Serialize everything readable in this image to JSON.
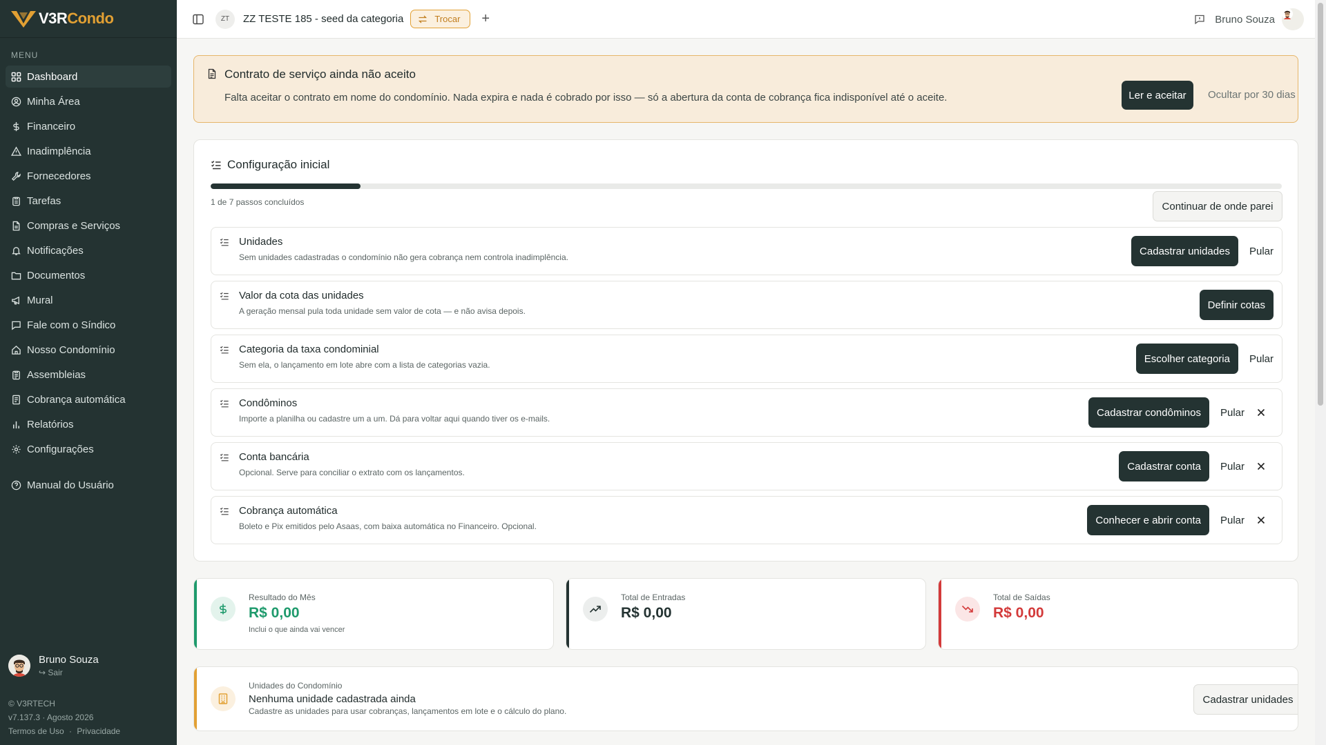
{
  "brand": {
    "part1": "V3R",
    "part2": "Condo"
  },
  "sidebar": {
    "menu_label": "MENU",
    "items": [
      {
        "label": "Dashboard",
        "icon": "dashboard-icon",
        "active": true
      },
      {
        "label": "Minha Área",
        "icon": "user-circle-icon"
      },
      {
        "label": "Financeiro",
        "icon": "dollar-icon"
      },
      {
        "label": "Inadimplência",
        "icon": "warning-triangle-icon"
      },
      {
        "label": "Fornecedores",
        "icon": "wrench-icon"
      },
      {
        "label": "Tarefas",
        "icon": "clipboard-icon"
      },
      {
        "label": "Compras e Serviços",
        "icon": "receipt-icon"
      },
      {
        "label": "Notificações",
        "icon": "bell-icon"
      },
      {
        "label": "Documentos",
        "icon": "folder-icon"
      },
      {
        "label": "Mural",
        "icon": "megaphone-icon"
      },
      {
        "label": "Fale com o Síndico",
        "icon": "chat-icon"
      },
      {
        "label": "Nosso Condomínio",
        "icon": "home-icon"
      },
      {
        "label": "Assembleias",
        "icon": "clipboard-list-icon"
      },
      {
        "label": "Cobrança automática",
        "icon": "invoice-icon"
      },
      {
        "label": "Relatórios",
        "icon": "bar-chart-icon"
      },
      {
        "label": "Configurações",
        "icon": "gear-icon"
      }
    ],
    "manual": "Manual do Usuário",
    "user_name": "Bruno Souza",
    "logout": "Sair",
    "footer": {
      "copyright": "© V3RTECH",
      "version": "v7.137.3 · Agosto 2026",
      "terms": "Termos de Uso",
      "sep": "·",
      "privacy": "Privacidade"
    }
  },
  "topbar": {
    "initials": "ZT",
    "condo_name": "ZZ TESTE 185 - seed da categoria",
    "switch_label": "Trocar",
    "plus": "+",
    "user_name": "Bruno Souza"
  },
  "contract": {
    "title": "Contrato de serviço ainda não aceito",
    "text": "Falta aceitar o contrato em nome do condomínio. Nada expira e nada é cobrado por isso — só a abertura da conta de cobrança fica indisponível até o aceite.",
    "accept": "Ler e aceitar",
    "hide": "Ocultar por 30 dias"
  },
  "setup": {
    "title": "Configuração inicial",
    "progress_fraction": 0.14,
    "progress_text": "1 de 7 passos concluídos",
    "continue": "Continuar de onde parei",
    "steps": [
      {
        "title": "Unidades",
        "desc": "Sem unidades cadastradas o condomínio não gera cobrança nem controla inadimplência.",
        "action": "Cadastrar unidades",
        "skip": "Pular"
      },
      {
        "title": "Valor da cota das unidades",
        "desc": "A geração mensal pula toda unidade sem valor de cota — e não avisa depois.",
        "action": "Definir cotas"
      },
      {
        "title": "Categoria da taxa condominial",
        "desc": "Sem ela, o lançamento em lote abre com a lista de categorias vazia.",
        "action": "Escolher categoria",
        "skip": "Pular"
      },
      {
        "title": "Condôminos",
        "desc": "Importe a planilha ou cadastre um a um. Dá para voltar aqui quando tiver os e-mails.",
        "action": "Cadastrar condôminos",
        "skip": "Pular",
        "dismiss": true
      },
      {
        "title": "Conta bancária",
        "desc": "Opcional. Serve para conciliar o extrato com os lançamentos.",
        "action": "Cadastrar conta",
        "skip": "Pular",
        "dismiss": true
      },
      {
        "title": "Cobrança automática",
        "desc": "Boleto e Pix emitidos pelo Asaas, com baixa automática no Financeiro. Opcional.",
        "action": "Conhecer e abrir conta",
        "skip": "Pular",
        "dismiss": true
      }
    ]
  },
  "summary": {
    "result": {
      "label": "Resultado do Mês",
      "value": "R$ 0,00",
      "note": "Inclui o que ainda vai vencer",
      "color": "#1e9a6c"
    },
    "income": {
      "label": "Total de Entradas",
      "value": "R$ 0,00",
      "color": "#243332"
    },
    "expense": {
      "label": "Total de Saídas",
      "value": "R$ 0,00",
      "color": "#d33a3a"
    }
  },
  "units_card": {
    "label": "Unidades do Condomínio",
    "title": "Nenhuma unidade cadastrada ainda",
    "desc": "Cadastre as unidades para usar cobranças, lançamentos em lote e o cálculo do plano.",
    "action": "Cadastrar unidades"
  }
}
